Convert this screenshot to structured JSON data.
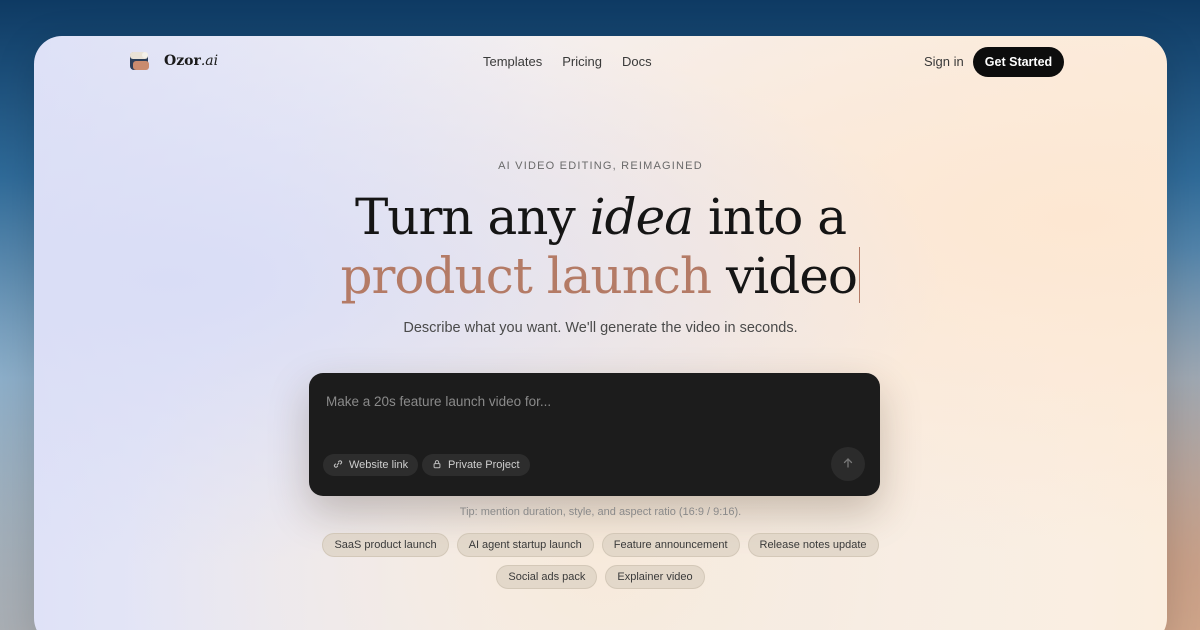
{
  "brand": {
    "name_main": "Ozor",
    "name_suffix": ".ai"
  },
  "nav": {
    "links": [
      "Templates",
      "Pricing",
      "Docs"
    ],
    "sign_in": "Sign in",
    "cta": "Get Started"
  },
  "hero": {
    "eyebrow": "AI VIDEO EDITING, REIMAGINED",
    "line1_start": "Turn any ",
    "line1_italic": "idea",
    "line1_end": " into a",
    "line2_accent": "product launch",
    "line2_end": " video",
    "subtitle": "Describe what you want. We'll generate the video in seconds."
  },
  "prompt": {
    "placeholder": "Make a 20s feature launch video for...",
    "chips": [
      {
        "label": "Website link",
        "icon": "link-icon"
      },
      {
        "label": "Private Project",
        "icon": "lock-icon"
      }
    ],
    "send_icon": "arrow-up-icon"
  },
  "tip": "Tip: mention duration, style, and aspect ratio (16:9 / 9:16).",
  "suggestions": {
    "row1": [
      "SaaS product launch",
      "AI agent startup launch",
      "Feature announcement",
      "Release notes update"
    ],
    "row2": [
      "Social ads pack",
      "Explainer video"
    ]
  },
  "colors": {
    "accent": "#b47b66",
    "cta_bg": "#0d0d0d",
    "prompt_bg": "#1c1c1c"
  }
}
